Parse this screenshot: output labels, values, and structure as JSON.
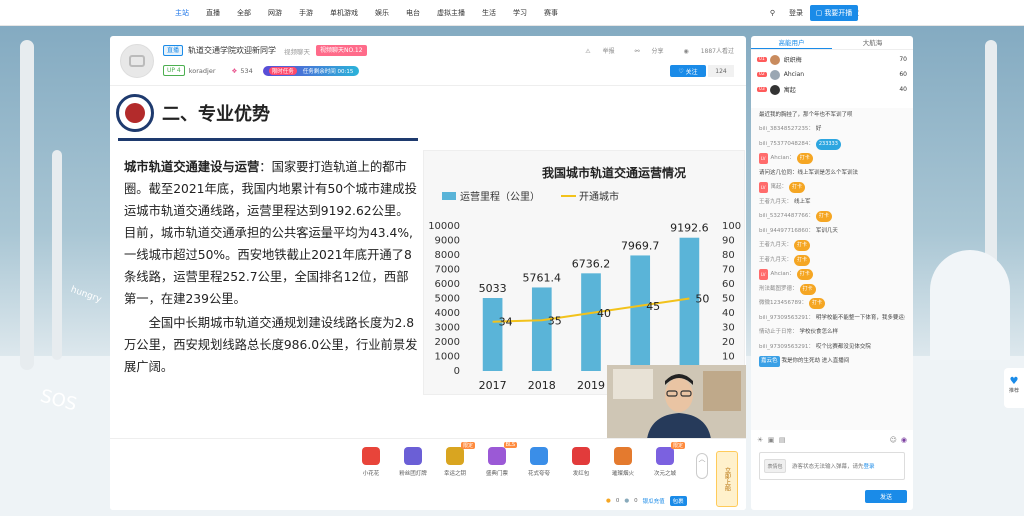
{
  "nav": {
    "links": [
      "主站",
      "直播",
      "全部",
      "网游",
      "手游",
      "单机游戏",
      "娱乐",
      "电台",
      "虚拟主播",
      "生活",
      "学习",
      "赛事"
    ],
    "login": "登录",
    "register": "注册",
    "member": "饭盒",
    "start_live": "我要开播"
  },
  "header": {
    "live_tag": "直播",
    "title": "轨道交通学院欢迎新同学",
    "category": "视频聊天",
    "rank_badge": "视频聊天NO.12",
    "up_level": "UP 4",
    "uploader": "koradjer",
    "fans": "534",
    "task_tag": "限时任务",
    "task_text": "任务剩余时间 00:15",
    "report": "举报",
    "share": "分享",
    "viewers": "1887人看过",
    "follow": "关注",
    "follow_count": "124"
  },
  "slide": {
    "title": "二、专业优势",
    "para1_bold": "城市轨道交通建设与运营",
    "para1": "：国家要打造轨道上的都市圈。截至2021年底，我国内地累计有50个城市建成投运城市轨道交通线路，运营里程达到9192.62公里。目前，城市轨道交通承担的公共客运量平均为43.4%,一线城市超过50%。西安地铁截止2021年底开通了8条线路，运营里程252.7公里，全国排名12位，西部第一，在建239公里。",
    "para2": "全国中长期城市轨道交通规划建设线路长度为2.8万公里，西安规划线路总长度986.0公里，行业前景发展广阔。"
  },
  "chart_data": {
    "type": "bar",
    "title": "我国城市轨道交通运营情况",
    "categories": [
      "2017",
      "2018",
      "2019",
      "2020",
      "2021"
    ],
    "visible_categories": [
      "2017",
      "2018",
      "2019"
    ],
    "series": [
      {
        "name": "运营里程（公里）",
        "type": "bar",
        "axis": "left",
        "values": [
          5033,
          5761.4,
          6736.2,
          7969.7,
          9192.6
        ],
        "labels": [
          "5033",
          "5761.4",
          "6736.2",
          "7969.7",
          "9192.6"
        ],
        "color": "#5ab4d8"
      },
      {
        "name": "开通城市",
        "type": "line",
        "axis": "right",
        "values": [
          34,
          35,
          40,
          45,
          50
        ],
        "labels": [
          "34",
          "35",
          "40",
          "45",
          "50"
        ],
        "color": "#f2c21b"
      }
    ],
    "ylim_left": [
      0,
      10000
    ],
    "yticks_left": [
      "0",
      "1000",
      "2000",
      "3000",
      "4000",
      "5000",
      "6000",
      "7000",
      "8000",
      "9000",
      "10000"
    ],
    "ylim_right": [
      0,
      100
    ],
    "yticks_right": [
      "0",
      "10",
      "20",
      "30",
      "40",
      "50",
      "60",
      "70",
      "80",
      "90",
      "100"
    ],
    "legend": "top",
    "grid": false
  },
  "gifts": [
    {
      "name": "小花花",
      "badge": "",
      "color": "#e8443a"
    },
    {
      "name": "粉丝团灯牌",
      "badge": "",
      "color": "#6b5fd6"
    },
    {
      "name": "幸运之钥",
      "badge": "限定",
      "color": "#d9a520"
    },
    {
      "name": "盛典门票",
      "badge": "BLS",
      "color": "#9b59d6"
    },
    {
      "name": "花式夸夸",
      "badge": "",
      "color": "#3a8ee8"
    },
    {
      "name": "发红包",
      "badge": "",
      "color": "#e23b3b"
    },
    {
      "name": "璀璨烟火",
      "badge": "",
      "color": "#e47a2e"
    },
    {
      "name": "次元之城",
      "badge": "限定",
      "color": "#7b61e0"
    }
  ],
  "giftbar": {
    "coin1": "0",
    "coin2": "0",
    "recharge": "银瓜充值",
    "package": "包裹",
    "up": "︿",
    "shelf": "立即上船"
  },
  "side": {
    "tab1": "高能用户",
    "tab2": "大航海",
    "rank": [
      {
        "name": "织织梅",
        "score": "70",
        "color": "#c98b5e"
      },
      {
        "name": "Ahcian",
        "score": "60",
        "color": "#9aa7b3"
      },
      {
        "name": "寓起",
        "score": "40",
        "color": "#333333"
      }
    ],
    "messages": [
      {
        "lv": "",
        "user": "",
        "text": "最近我的胸挂了，那个年也不军训了呗",
        "extra": ""
      },
      {
        "lv": "",
        "user": "bili_38348527235：",
        "text": "好",
        "extra": ""
      },
      {
        "lv": "",
        "user": "bili_75377048284：",
        "text": "",
        "extra": "233333"
      },
      {
        "lv": "LV",
        "user": "Ahcian：",
        "text": "",
        "extra": "打卡"
      },
      {
        "lv": "",
        "user": "",
        "text": "请问这几位同：线上军训是怎么个军训法",
        "extra": ""
      },
      {
        "lv": "LV",
        "user": "寓起：",
        "text": "",
        "extra": "打卡"
      },
      {
        "lv": "",
        "user": "王者九月天：",
        "text": "线上军",
        "extra": ""
      },
      {
        "lv": "",
        "user": "bili_53274487766：",
        "text": "",
        "extra": "打卡"
      },
      {
        "lv": "",
        "user": "bili_94497716860：",
        "text": "军训几天",
        "extra": ""
      },
      {
        "lv": "",
        "user": "王者九月天：",
        "text": "",
        "extra": "打卡"
      },
      {
        "lv": "",
        "user": "王者九月天：",
        "text": "",
        "extra": "打卡"
      },
      {
        "lv": "LV",
        "user": "Ahcian：",
        "text": "",
        "extra": "打卡"
      },
      {
        "lv": "",
        "user": "刑法截图罗德：",
        "text": "",
        "extra": "打卡"
      },
      {
        "lv": "",
        "user": "微微123456789：",
        "text": "",
        "extra": "打卡"
      },
      {
        "lv": "",
        "user": "bili_97309563291：",
        "text": "明学校能不能整一下体育，我多要运会都没见",
        "extra": ""
      },
      {
        "lv": "",
        "user": "情动止于日常：",
        "text": "学校伙食怎么样",
        "extra": ""
      },
      {
        "lv": "",
        "user": "bili_97309563291：",
        "text": "哎个比赛都没见体交院",
        "extra": ""
      },
      {
        "lv": "",
        "user": "嘉云色",
        "text": "我是你的生死劫 进入直播间",
        "extra": ""
      }
    ],
    "input_tag": "表情包",
    "input_placeholder": "游客状态无法输入弹幕，请先",
    "input_login": "登录",
    "send": "发送"
  },
  "float": {
    "label": "推荐"
  },
  "decor": {
    "hungry": "hungry",
    "sos": "SOS"
  }
}
